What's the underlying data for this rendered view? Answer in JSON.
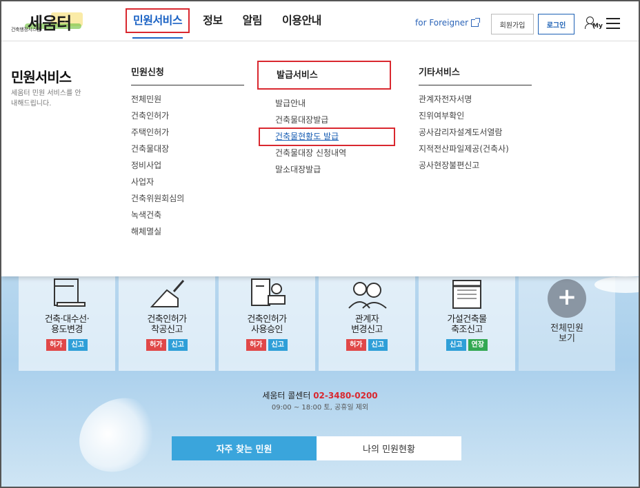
{
  "logo": {
    "text": "세움터",
    "subtitle": "건축행정시스템"
  },
  "gnb": [
    {
      "label": "민원서비스"
    },
    {
      "label": "정보"
    },
    {
      "label": "알림"
    },
    {
      "label": "이용안내"
    }
  ],
  "utility": {
    "foreigner": "for Foreigner",
    "join": "회원가입",
    "login": "로그인",
    "my": "My"
  },
  "mega": {
    "title": "민원서비스",
    "desc": "세움터 민원 서비스를 안내해드립니다.",
    "columns": [
      {
        "title": "민원신청",
        "items": [
          "전체민원",
          "건축인허가",
          "주택인허가",
          "건축물대장",
          "정비사업",
          "사업자",
          "건축위원회심의",
          "녹색건축",
          "해체멸실"
        ]
      },
      {
        "title": "발급서비스",
        "items": [
          "발급안내",
          "건축물대장발급",
          "건축물현황도 발급",
          "건축물대장 신청내역",
          "말소대장발급"
        ]
      },
      {
        "title": "기타서비스",
        "items": [
          "관계자전자서명",
          "진위여부확인",
          "공사감리자설계도서열람",
          "지적전산파일제공(건축사)",
          "공사현장불편신고"
        ]
      }
    ]
  },
  "cards": [
    {
      "label": "건축·대수선·\n용도변경",
      "tags": [
        {
          "t": "허가",
          "c": "red"
        },
        {
          "t": "신고",
          "c": "blue"
        }
      ]
    },
    {
      "label": "건축인허가\n착공신고",
      "tags": [
        {
          "t": "허가",
          "c": "red"
        },
        {
          "t": "신고",
          "c": "blue"
        }
      ]
    },
    {
      "label": "건축인허가\n사용승인",
      "tags": [
        {
          "t": "허가",
          "c": "red"
        },
        {
          "t": "신고",
          "c": "blue"
        }
      ]
    },
    {
      "label": "관계자\n변경신고",
      "tags": [
        {
          "t": "허가",
          "c": "red"
        },
        {
          "t": "신고",
          "c": "blue"
        }
      ]
    },
    {
      "label": "가설건축물\n축조신고",
      "tags": [
        {
          "t": "신고",
          "c": "blue"
        },
        {
          "t": "연장",
          "c": "green"
        }
      ]
    }
  ],
  "plus_card": {
    "symbol": "+",
    "label": "전체민원\n보기"
  },
  "call": {
    "label": "세움터 콜센터 ",
    "number": "02-3480-0200",
    "hours": "09:00 ~ 18:00 토, 공휴일 제외"
  },
  "tabs": [
    {
      "label": "자주 찾는 민원"
    },
    {
      "label": "나의 민원현황"
    }
  ]
}
